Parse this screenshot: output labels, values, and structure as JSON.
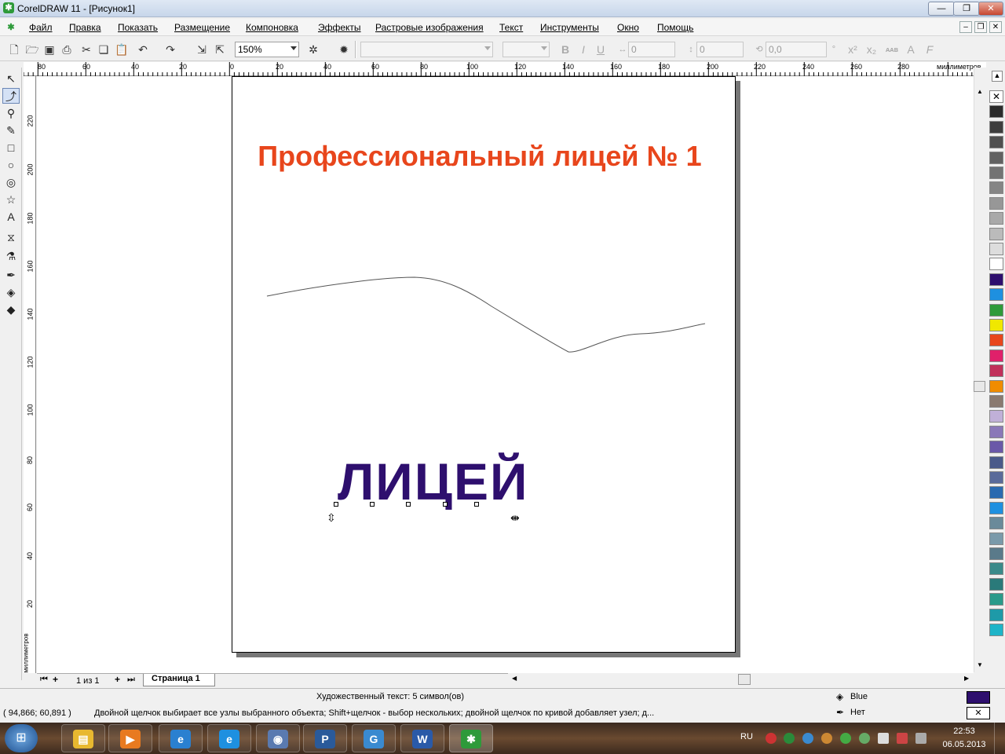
{
  "window": {
    "title": "CorelDRAW 11 - [Рисунок1]",
    "app_icon": "coreldraw-icon"
  },
  "menu": [
    "Файл",
    "Правка",
    "Показать",
    "Размещение",
    "Компоновка",
    "Эффекты",
    "Растровые изображения",
    "Текст",
    "Инструменты",
    "Окно",
    "Помощь"
  ],
  "toolbar": {
    "zoom": "150%",
    "font_name": "",
    "font_size": "",
    "spacing_a": "0",
    "spacing_b": "0",
    "angle": "0,0",
    "angle_unit": "°",
    "text_btns": "ᴀᴀʙ"
  },
  "hruler": {
    "unit": "миллиметров",
    "ticks": [
      "80",
      "60",
      "40",
      "20",
      "0",
      "20",
      "40",
      "60",
      "80",
      "100",
      "120",
      "140",
      "160",
      "180",
      "200",
      "220",
      "240",
      "260",
      "280"
    ]
  },
  "vruler": {
    "unit": "миллиметров",
    "ticks": [
      "220",
      "200",
      "180",
      "160",
      "140",
      "120",
      "100",
      "80",
      "60",
      "40",
      "20"
    ]
  },
  "document": {
    "title_text": "Профессиональный лицей № 1",
    "title_color": "#e8461c",
    "art_text": "ЛИЦЕЙ",
    "art_color": "#2e0f6e"
  },
  "pagebar": {
    "page_count": "1 из 1",
    "page_tab": "Страница 1"
  },
  "status": {
    "object_info": "Художественный текст: 5 символ(ов)",
    "coords": "( 94,866; 60,891 )",
    "hint": "Двойной щелчок выбирает все узлы выбранного объекта; Shift+щелчок - выбор нескольких; двойной щелчок по кривой добавляет узел; д...",
    "fill_label": "Blue",
    "fill_color": "#2e0f6e",
    "outline_label": "Нет"
  },
  "palette": [
    "none",
    "#2b2b2b",
    "#3d3d3d",
    "#4f4f4f",
    "#616161",
    "#737373",
    "#858585",
    "#979797",
    "#a9a9a9",
    "#bbbbbb",
    "#dddddd",
    "#ffffff",
    "#2e0f6e",
    "#1e90e0",
    "#2e9a3a",
    "#f0e800",
    "#e8461c",
    "#e0206a",
    "#c0305a",
    "#f08c00",
    "#8a7a70",
    "#c0b0d8",
    "#8a78b8",
    "#6a58a8",
    "#4a5a8a",
    "#5a6a9a",
    "#2a6ab0",
    "#1e90e0",
    "#6a8a9a",
    "#7a9aaa",
    "#5a7a8a",
    "#3a8a8a",
    "#2a7a7a",
    "#2a9a8a",
    "#1e9aa8",
    "#1eb4c8"
  ],
  "taskbar": {
    "lang": "RU",
    "time": "22:53",
    "date": "06.05.2013",
    "apps": [
      "explorer-icon",
      "media-player-icon",
      "ie-icon",
      "ie-alt-icon",
      "browser-icon",
      "pdf-icon",
      "chrome-icon",
      "word-icon",
      "coreldraw-icon"
    ]
  }
}
